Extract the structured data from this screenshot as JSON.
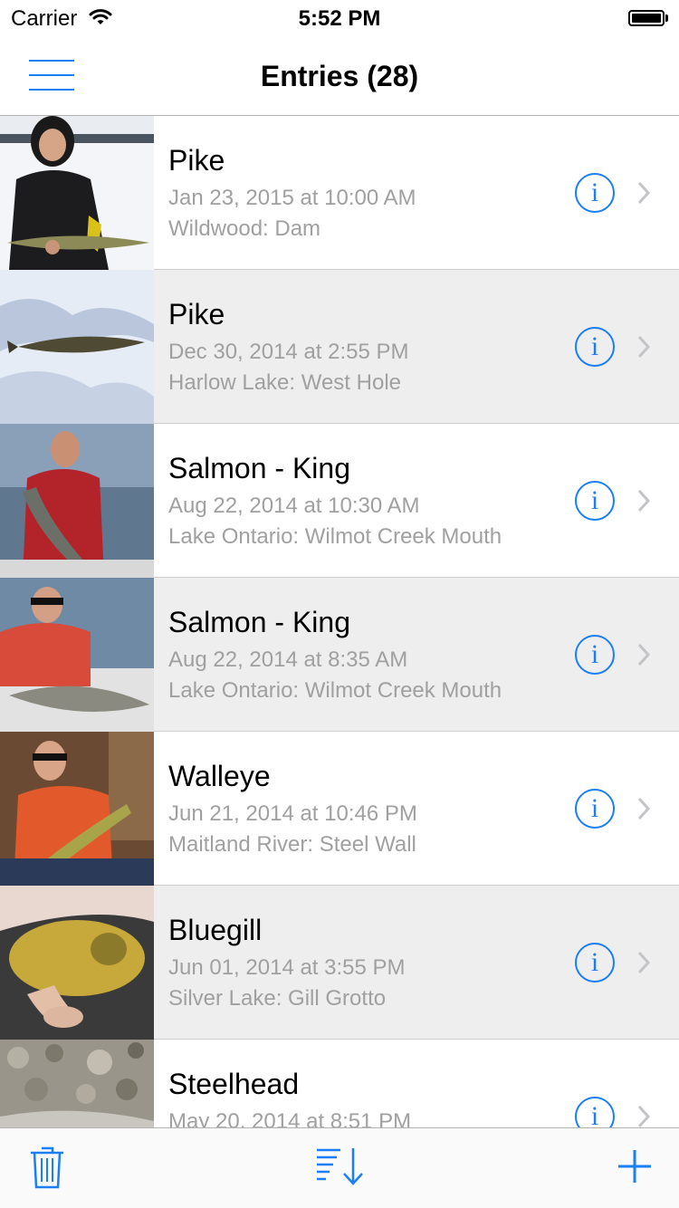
{
  "status_bar": {
    "carrier": "Carrier",
    "time": "5:52 PM",
    "battery_icon": "battery-full-icon",
    "wifi_icon": "wifi-icon"
  },
  "nav": {
    "title": "Entries (28)",
    "menu_icon": "hamburger-menu-icon"
  },
  "colors": {
    "accent": "#1a7ef6",
    "secondary_text": "#a0a0a0",
    "alt_row": "#eeeeee"
  },
  "entries": [
    {
      "species": "Pike",
      "date": "Jan 23, 2015 at 10:00 AM",
      "location": "Wildwood: Dam"
    },
    {
      "species": "Pike",
      "date": "Dec 30, 2014 at 2:55 PM",
      "location": "Harlow Lake: West Hole"
    },
    {
      "species": "Salmon - King",
      "date": "Aug 22, 2014 at 10:30 AM",
      "location": "Lake Ontario: Wilmot Creek Mouth"
    },
    {
      "species": "Salmon - King",
      "date": "Aug 22, 2014 at 8:35 AM",
      "location": "Lake Ontario: Wilmot Creek Mouth"
    },
    {
      "species": "Walleye",
      "date": "Jun 21, 2014 at 10:46 PM",
      "location": "Maitland River: Steel Wall"
    },
    {
      "species": "Bluegill",
      "date": "Jun 01, 2014 at 3:55 PM",
      "location": "Silver Lake: Gill Grotto"
    },
    {
      "species": "Steelhead",
      "date": "May 20, 2014 at 8:51 PM",
      "location": ""
    }
  ],
  "row_icons": {
    "info": "info-icon",
    "info_glyph": "i",
    "disclosure": "chevron-right-icon"
  },
  "toolbar": {
    "delete_icon": "trash-icon",
    "sort_icon": "sort-descending-icon",
    "add_icon": "plus-icon"
  }
}
